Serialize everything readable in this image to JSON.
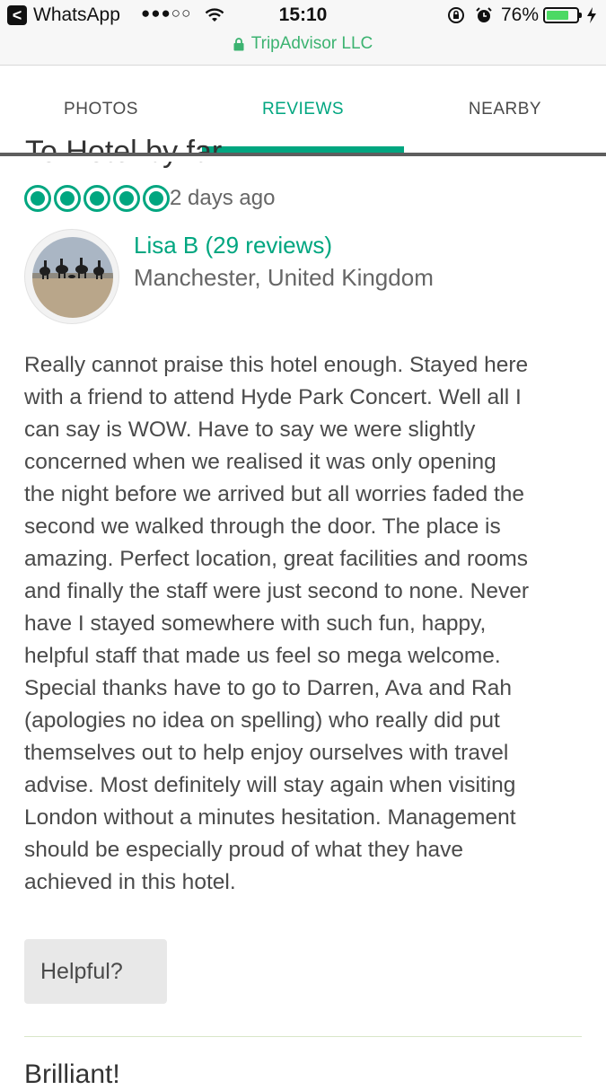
{
  "status_bar": {
    "back_glyph": "<",
    "app": "WhatsApp",
    "signal": "●●●○○",
    "time": "15:10",
    "battery_percent": "76%",
    "battery_level": 0.76,
    "icons": [
      "back-icon",
      "wifi-icon",
      "rotation-lock-icon",
      "alarm-icon",
      "battery-icon",
      "charging-icon"
    ]
  },
  "url_bar": {
    "site": "TripAdvisor LLC",
    "icon": "lock-icon"
  },
  "tabs": [
    {
      "label": "PHOTOS",
      "active": false
    },
    {
      "label": "REVIEWS",
      "active": true
    },
    {
      "label": "NEARBY",
      "active": false
    }
  ],
  "review": {
    "title_fragment": "To Hotel by far",
    "rating_bubbles": 5,
    "rating_max": 5,
    "date": "2 days ago",
    "reviewer": {
      "name": "Lisa B (29 reviews)",
      "location": "Manchester, United Kingdom"
    },
    "text": "Really cannot praise this hotel enough. Stayed here\nwith a friend to attend Hyde Park Concert. Well all I\ncan say is WOW. Have to say we were slightly\nconcerned when we realised it was only opening\nthe night before we arrived but all worries faded the\nsecond we walked through the door. The place is\namazing. Perfect location, great facilities and rooms\nand finally the staff were just second to none. Never\nhave I stayed somewhere with such fun, happy,\nhelpful staff that made us feel so mega welcome.\nSpecial thanks have to go to Darren, Ava and Rah\n(apologies no idea on spelling) who really did put\nthemselves out to help enjoy ourselves with travel\nadvise. Most definitely will stay again when visiting\nLondon without a minutes hesitation. Management\nshould be especially proud of what they have\nachieved in this hotel.",
    "helpful_label": "Helpful?"
  },
  "next_review": {
    "title_fragment": "Brilliant!"
  },
  "colors": {
    "accent": "#00a680",
    "text": "#4a4a4a",
    "button_bg": "#e8e8e8"
  }
}
